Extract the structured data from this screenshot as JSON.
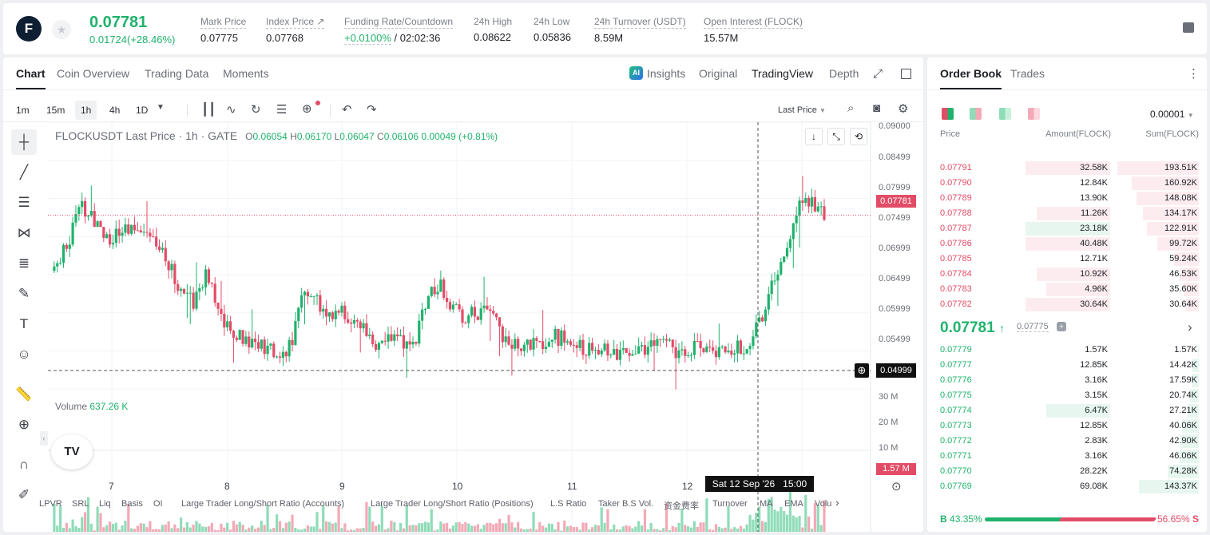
{
  "header": {
    "logo_letter": "F",
    "price": "0.07781",
    "change": "0.01724(+28.46%)",
    "stats": [
      {
        "label": "Mark Price",
        "value": "0.07775"
      },
      {
        "label": "Index Price ↗",
        "value": "0.07768"
      },
      {
        "label": "Funding Rate/Countdown",
        "value_g": "+0.0100%",
        "value": " / 02:02:36"
      },
      {
        "label": "24h High",
        "value": "0.08622"
      },
      {
        "label": "24h Low",
        "value": "0.05836"
      },
      {
        "label": "24h Turnover (USDT)",
        "value": "8.59M"
      },
      {
        "label": "Open Interest (FLOCK)",
        "value": "15.57M"
      }
    ]
  },
  "chart_tabs": [
    "Chart",
    "Coin Overview",
    "Trading Data",
    "Moments"
  ],
  "view_tabs": {
    "insights": "Insights",
    "original": "Original",
    "tradingview": "TradingView",
    "depth": "Depth"
  },
  "intervals": [
    "1m",
    "15m",
    "1h",
    "4h",
    "1D"
  ],
  "price_type": "Last Price",
  "legend": {
    "symbol": "FLOCKUSDT Last Price · 1h · GATE",
    "o": "0.06054",
    "h": "0.06170",
    "l": "0.06047",
    "c": "0.06106",
    "chg": "0.00049 (+0.81%)",
    "o_l": "O",
    "h_l": "H",
    "l_l": "L",
    "c_l": "C"
  },
  "volume": {
    "label": "Volume",
    "value": "637.26 K"
  },
  "price_axis": [
    "0.09000",
    "0.08499",
    "0.07999",
    "0.07499",
    "0.06999",
    "0.06499",
    "0.05999",
    "0.05499"
  ],
  "last_price_tag": "0.07781",
  "cross_price_tag": "0.04999",
  "vol_axis": [
    "30 M",
    "20 M",
    "10 M"
  ],
  "vol_tag": "1.57 M",
  "time_axis": [
    "7",
    "8",
    "9",
    "10",
    "11",
    "12"
  ],
  "cross_time": "Sat 12 Sep '26   15:00",
  "tv_logo": "TV",
  "indicators": [
    "LPVR",
    "SRL",
    "Liq",
    "Basis",
    "OI",
    "Large Trader Long/Short Ratio (Accounts)",
    "Large Trader Long/Short Ratio (Positions)",
    "L.S Ratio",
    "Taker B.S Vol.",
    "资金费率",
    "Turnover",
    "MA",
    "EMA",
    "Volu"
  ],
  "colors": {
    "up": "#20b26c",
    "down": "#e34c67"
  },
  "book": {
    "tabs": [
      "Order Book",
      "Trades"
    ],
    "precision": "0.00001",
    "cols": [
      "Price",
      "Amount(FLOCK)",
      "Sum(FLOCK)"
    ],
    "asks": [
      [
        "0.07791",
        "32.58K",
        "193.51K"
      ],
      [
        "0.07790",
        "12.84K",
        "160.92K"
      ],
      [
        "0.07789",
        "13.90K",
        "148.08K"
      ],
      [
        "0.07788",
        "11.26K",
        "134.17K"
      ],
      [
        "0.07787",
        "23.18K",
        "122.91K"
      ],
      [
        "0.07786",
        "40.48K",
        "99.72K"
      ],
      [
        "0.07785",
        "12.71K",
        "59.24K"
      ],
      [
        "0.07784",
        "10.92K",
        "46.53K"
      ],
      [
        "0.07783",
        "4.96K",
        "35.60K"
      ],
      [
        "0.07782",
        "30.64K",
        "30.64K"
      ]
    ],
    "mid_price": "0.07781",
    "mid_arrow": "↑",
    "mark": "0.07775",
    "bids": [
      [
        "0.07779",
        "1.57K",
        "1.57K"
      ],
      [
        "0.07777",
        "12.85K",
        "14.42K"
      ],
      [
        "0.07776",
        "3.16K",
        "17.59K"
      ],
      [
        "0.07775",
        "3.15K",
        "20.74K"
      ],
      [
        "0.07774",
        "6.47K",
        "27.21K"
      ],
      [
        "0.07773",
        "12.85K",
        "40.06K"
      ],
      [
        "0.07772",
        "2.83K",
        "42.90K"
      ],
      [
        "0.07771",
        "3.16K",
        "46.06K"
      ],
      [
        "0.07770",
        "28.22K",
        "74.28K"
      ],
      [
        "0.07769",
        "69.08K",
        "143.37K"
      ]
    ],
    "buy_label": "B",
    "buy_pct": "43.35%",
    "sell_pct": "56.65%",
    "sell_label": "S",
    "buy_ratio": 43.35
  }
}
